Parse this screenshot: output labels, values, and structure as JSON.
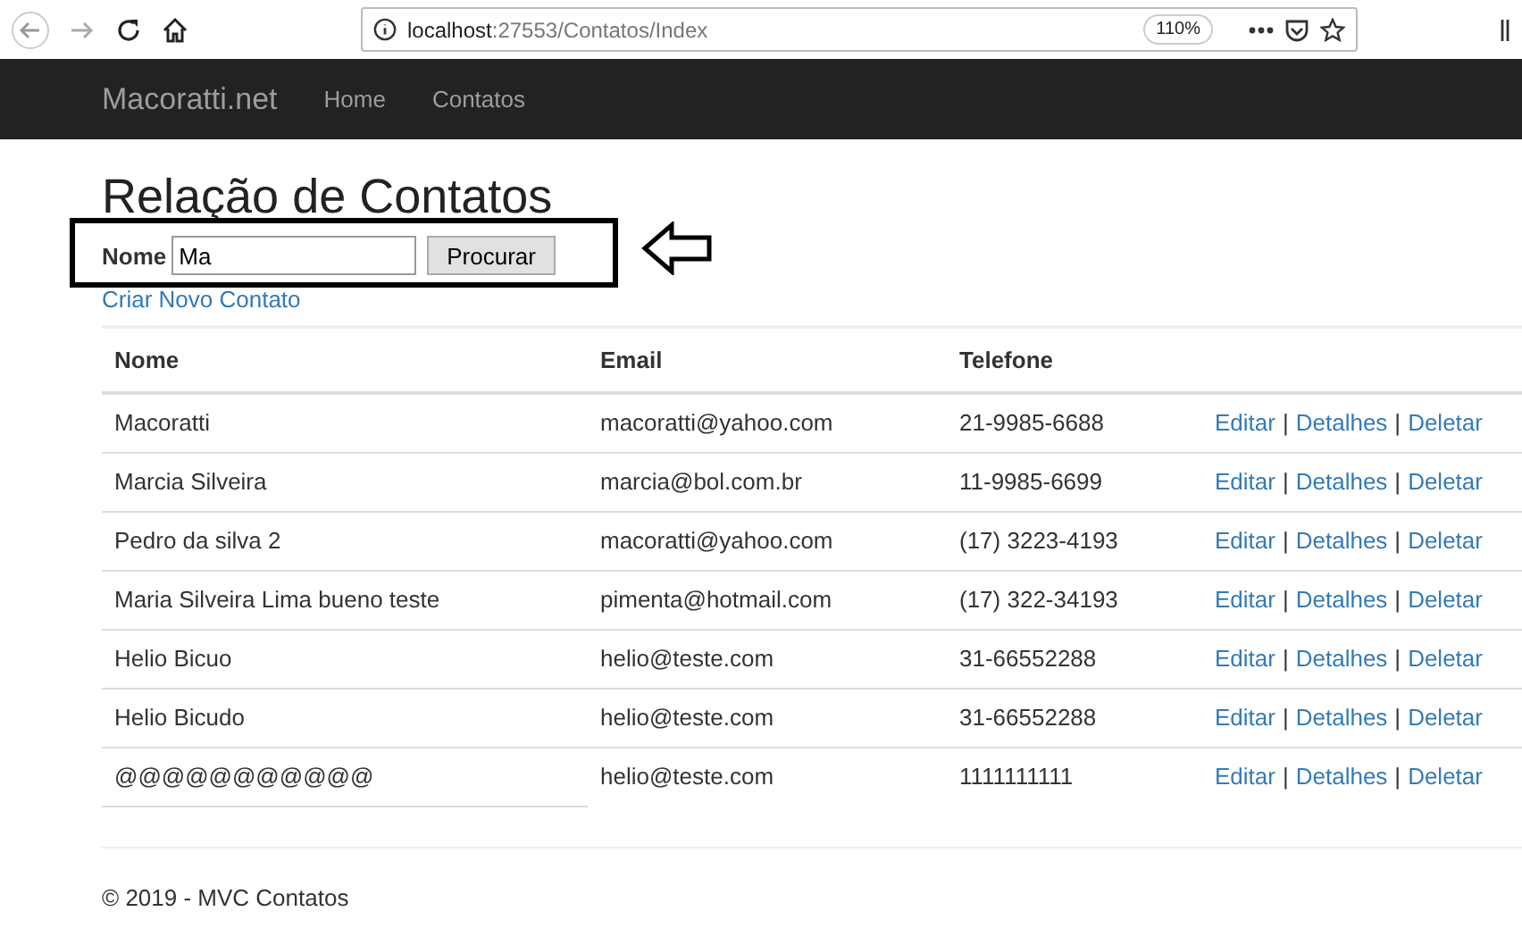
{
  "browser": {
    "url_host": "localhost",
    "url_path": ":27553/Contatos/Index",
    "zoom": "110%"
  },
  "navbar": {
    "brand": "Macoratti.net",
    "links": [
      "Home",
      "Contatos"
    ]
  },
  "heading": "Relação de Contatos",
  "search": {
    "label": "Nome",
    "value": "Ma",
    "button": "Procurar"
  },
  "create_link": "Criar Novo Contato",
  "table": {
    "columns": [
      "Nome",
      "Email",
      "Telefone"
    ],
    "rows": [
      {
        "nome": "Macoratti",
        "email": "macoratti@yahoo.com",
        "telefone": "21-9985-6688",
        "actions": [
          {
            "kind": "link",
            "text": "Editar"
          },
          {
            "kind": "separator",
            "text": "|"
          },
          {
            "kind": "link",
            "text": "Detalhes"
          },
          {
            "kind": "separator",
            "text": "|"
          },
          {
            "kind": "link",
            "text": "Deletar"
          }
        ]
      },
      {
        "nome": "Marcia Silveira",
        "email": "marcia@bol.com.br",
        "telefone": "11-9985-6699",
        "actions": [
          {
            "kind": "link",
            "text": "Editar"
          },
          {
            "kind": "separator",
            "text": "|"
          },
          {
            "kind": "link",
            "text": "Detalhes"
          },
          {
            "kind": "separator",
            "text": "|"
          },
          {
            "kind": "link",
            "text": "Deletar"
          }
        ]
      },
      {
        "nome": "Pedro da silva 2",
        "email": "macoratti@yahoo.com",
        "telefone": "(17) 3223-4193",
        "actions": [
          {
            "kind": "link",
            "text": "Editar"
          },
          {
            "kind": "separator",
            "text": "|"
          },
          {
            "kind": "link",
            "text": "Detalhes"
          },
          {
            "kind": "separator",
            "text": "|"
          },
          {
            "kind": "link",
            "text": "Deletar"
          }
        ]
      },
      {
        "nome": "Maria Silveira Lima bueno teste",
        "email": "pimenta@hotmail.com",
        "telefone": "(17) 322-34193",
        "actions": [
          {
            "kind": "link",
            "text": "Editar"
          },
          {
            "kind": "separator",
            "text": "|"
          },
          {
            "kind": "link",
            "text": "Detalhes"
          },
          {
            "kind": "separator",
            "text": "|"
          },
          {
            "kind": "link",
            "text": "Deletar"
          }
        ]
      },
      {
        "nome": "Helio Bicuo",
        "email": "helio@teste.com",
        "telefone": "31-66552288",
        "actions": [
          {
            "kind": "link",
            "text": "Editar"
          },
          {
            "kind": "separator",
            "text": "|"
          },
          {
            "kind": "link",
            "text": "Detalhes"
          },
          {
            "kind": "separator",
            "text": "|"
          },
          {
            "kind": "link",
            "text": "Deletar"
          }
        ]
      },
      {
        "nome": "Helio Bicudo",
        "email": "helio@teste.com",
        "telefone": "31-66552288",
        "actions": [
          {
            "kind": "link",
            "text": "Editar"
          },
          {
            "kind": "separator",
            "text": "|"
          },
          {
            "kind": "link",
            "text": "Detalhes"
          },
          {
            "kind": "separator",
            "text": "|"
          },
          {
            "kind": "link",
            "text": "Deletar"
          }
        ]
      },
      {
        "nome": "@@@@@@@@@@@",
        "email": "helio@teste.com",
        "telefone": "1111111111",
        "actions": [
          {
            "kind": "link",
            "text": "Editar"
          },
          {
            "kind": "separator",
            "text": "|"
          },
          {
            "kind": "link",
            "text": "Detalhes"
          },
          {
            "kind": "separator",
            "text": "|"
          },
          {
            "kind": "link",
            "text": "Deletar"
          }
        ]
      }
    ]
  },
  "footer": "© 2019 - MVC Contatos"
}
